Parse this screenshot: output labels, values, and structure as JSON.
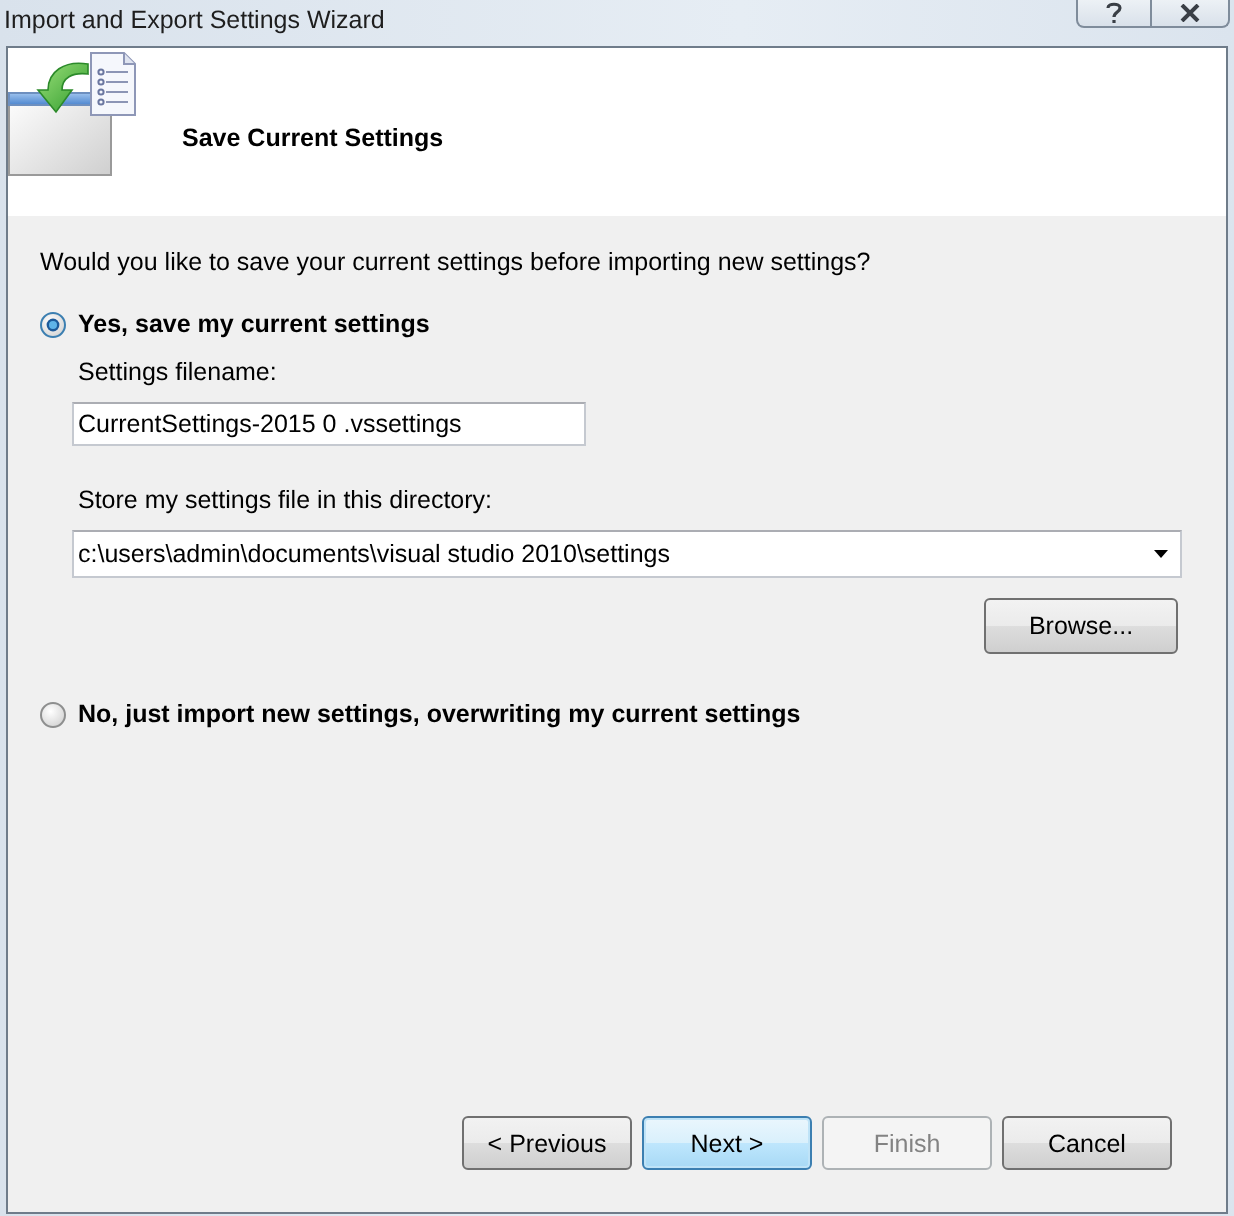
{
  "window": {
    "title": "Import and Export Settings Wizard"
  },
  "header": {
    "title": "Save Current Settings"
  },
  "question": "Would you like to save your current settings before importing new settings?",
  "options": [
    {
      "label": "Yes, save my current settings",
      "selected": true,
      "kind": "save",
      "filename_label": "Settings filename:",
      "filename": "CurrentSettings-2015 0 .vssettings",
      "directory_label": "Store my settings file in this directory:",
      "directory": "c:\\users\\admin\\documents\\visual studio 2010\\settings",
      "browse_button": "Browse..."
    },
    {
      "label": "No, just import new settings, overwriting my current settings",
      "selected": false,
      "kind": "plain"
    }
  ],
  "buttons": [
    {
      "label": "< Previous",
      "disabled": false,
      "default": false
    },
    {
      "label": "Next >",
      "disabled": false,
      "default": true
    },
    {
      "label": "Finish",
      "disabled": true,
      "default": false
    },
    {
      "label": "Cancel",
      "disabled": false,
      "default": false
    }
  ]
}
